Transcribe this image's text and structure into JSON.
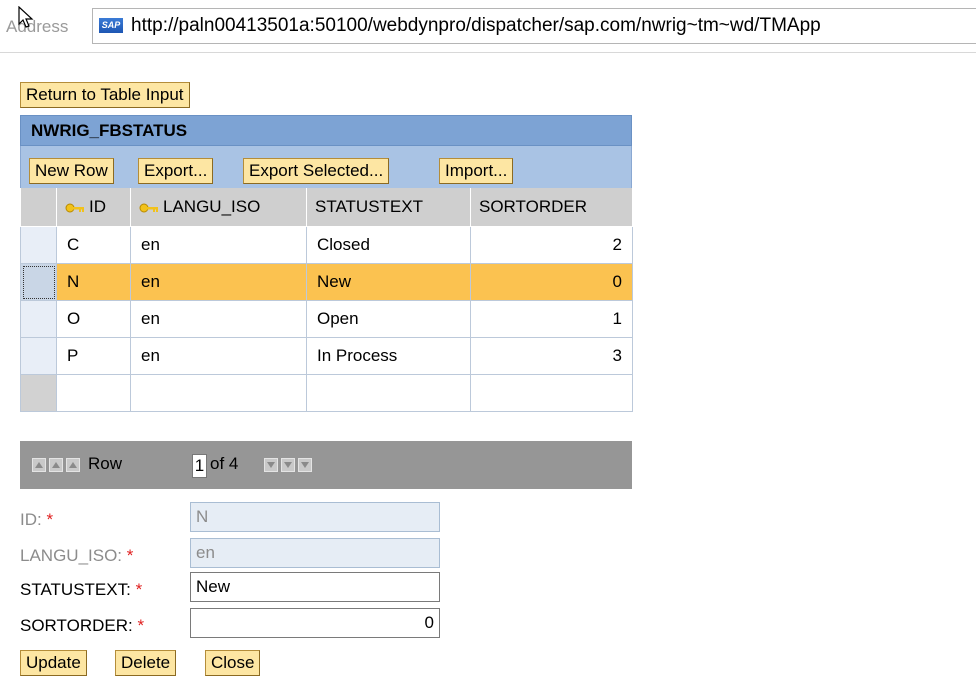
{
  "address_bar": {
    "label": "Address",
    "url": "http://paln00413501a:50100/webdynpro/dispatcher/sap.com/nwrig~tm~wd/TMApp",
    "logo_text": "SAP"
  },
  "return_button": "Return to Table Input",
  "table": {
    "title": "NWRIG_FBSTATUS",
    "toolbar": [
      "New Row",
      "Export...",
      "Export Selected...",
      "Import..."
    ],
    "columns": [
      "ID",
      "LANGU_ISO",
      "STATUSTEXT",
      "SORTORDER"
    ],
    "key_icon": "key-icon",
    "rows": [
      {
        "id": "C",
        "langu": "en",
        "status": "Closed",
        "sort": "2"
      },
      {
        "id": "N",
        "langu": "en",
        "status": "New",
        "sort": "0"
      },
      {
        "id": "O",
        "langu": "en",
        "status": "Open",
        "sort": "1"
      },
      {
        "id": "P",
        "langu": "en",
        "status": "In Process",
        "sort": "3"
      }
    ],
    "selected_row_index": 1,
    "colors": {
      "header": "#7da3d4",
      "toolbar": "#a9c3e4",
      "selected": "#fbc250",
      "button": "#fde6a3"
    }
  },
  "pager": {
    "row_label": "Row",
    "row_value": "1",
    "of_label": "of 4"
  },
  "form": {
    "id_label": "ID:",
    "id_value": "N",
    "langu_label": "LANGU_ISO:",
    "langu_value": "en",
    "status_label": "STATUSTEXT:",
    "status_value": "New",
    "sort_label": "SORTORDER:",
    "sort_value": "0",
    "required_marker": "*"
  },
  "actions": [
    "Update",
    "Delete",
    "Close"
  ]
}
